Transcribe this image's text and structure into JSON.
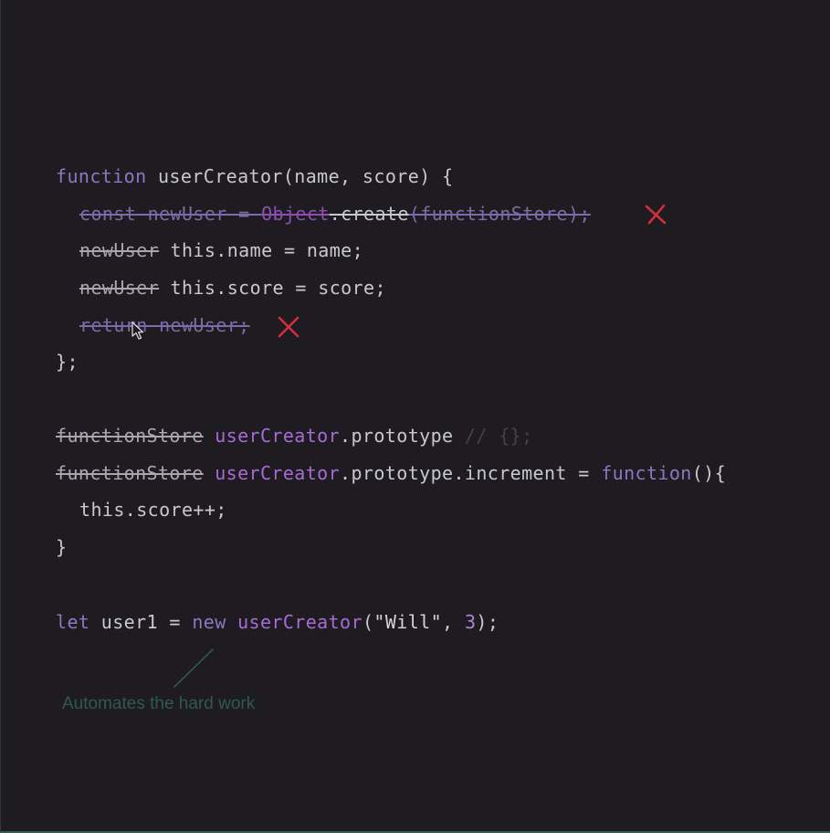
{
  "code": {
    "line1": {
      "kw": "function",
      "name": "userCreator",
      "rest": "(name, score) {"
    },
    "line2": {
      "a": "const newUser = ",
      "b": "Object",
      "c": ".create",
      "d": "(functionStore);"
    },
    "line3": {
      "struck": "newUser",
      "rest": " this.name = name;"
    },
    "line4": {
      "struck": "newUser",
      "rest": " this.score = score;"
    },
    "line5": {
      "struck": "return newUser;"
    },
    "line6": {
      "text": "};"
    },
    "line7": {
      "struck": "functionStore",
      "cls": "userCreator",
      "rest": ".prototype ",
      "comment": "// {};"
    },
    "line8": {
      "struck": "functionStore",
      "cls": "userCreator",
      "rest": ".prototype.increment = ",
      "kw": "function",
      "tail": "(){"
    },
    "line9": {
      "text": "this.score++;"
    },
    "line10": {
      "text": "}"
    },
    "line11": {
      "kw": "let",
      "var": " user1 = ",
      "kw2": "new",
      "cls": " userCreator",
      "open": "(",
      "str": "\"Will\"",
      "comma": ", ",
      "num": "3",
      "close": ");"
    }
  },
  "annotation": {
    "text": "Automates the hard work"
  },
  "colors": {
    "background": "#1e1c21",
    "keyword": "#8a78c4",
    "class_name": "#a86bd6",
    "text": "#c9c7cf",
    "x_mark": "#d22e3c",
    "annotation": "#2f5a4a"
  },
  "icons": {
    "x_mark": "red-x-icon",
    "cursor": "mouse-pointer-icon"
  }
}
